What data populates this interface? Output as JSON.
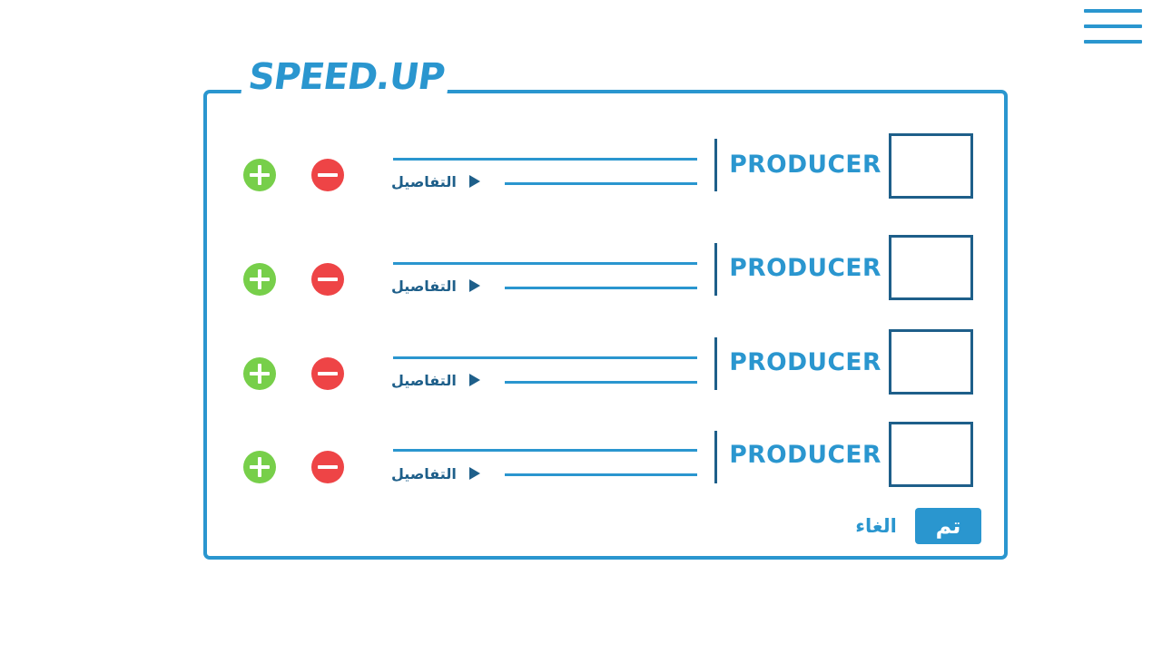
{
  "app": {
    "logo_text": "SPEED.UP"
  },
  "menu": {
    "icon": "hamburger-menu-icon"
  },
  "rows": [
    {
      "title": "PRODUCER",
      "details_label": "التفاصيل"
    },
    {
      "title": "PRODUCER",
      "details_label": "التفاصيل"
    },
    {
      "title": "PRODUCER",
      "details_label": "التفاصيل"
    },
    {
      "title": "PRODUCER",
      "details_label": "التفاصيل"
    }
  ],
  "footer": {
    "done_label": "تم",
    "cancel_label": "الغاء"
  },
  "colors": {
    "accent": "#2a96cf",
    "dark_accent": "#1e5f8a",
    "add": "#77cf4a",
    "remove": "#ee4446"
  }
}
